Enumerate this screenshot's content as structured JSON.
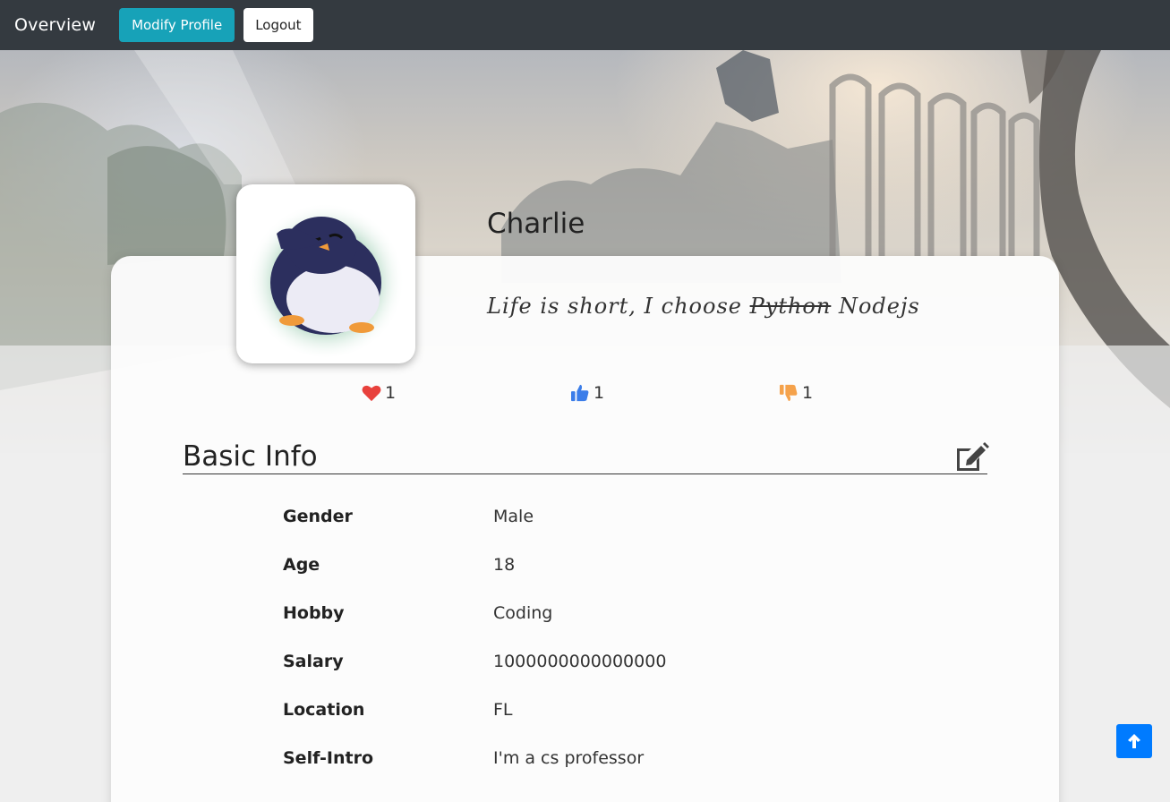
{
  "navbar": {
    "brand": "Overview",
    "modify_label": "Modify Profile",
    "logout_label": "Logout"
  },
  "profile": {
    "name": "Charlie",
    "motto_prefix": "Life is short, I choose ",
    "motto_struck": "Python",
    "motto_suffix": " Nodejs",
    "avatar_icon": "penguin-avatar"
  },
  "stats": {
    "likes": "1",
    "thumbs_up": "1",
    "thumbs_down": "1"
  },
  "basic_info": {
    "title": "Basic Info",
    "rows": [
      {
        "label": "Gender",
        "value": "Male"
      },
      {
        "label": "Age",
        "value": "18"
      },
      {
        "label": "Hobby",
        "value": "Coding"
      },
      {
        "label": "Salary",
        "value": "1000000000000000"
      },
      {
        "label": "Location",
        "value": "FL"
      },
      {
        "label": "Self-Intro",
        "value": "I'm a cs professor"
      }
    ]
  },
  "colors": {
    "navbar": "#343a40",
    "modify_button": "#17a2b8",
    "heart": "#e8413c",
    "thumbs_up": "#3b7de9",
    "thumbs_down": "#f5a24b",
    "back_to_top": "#007bff"
  }
}
